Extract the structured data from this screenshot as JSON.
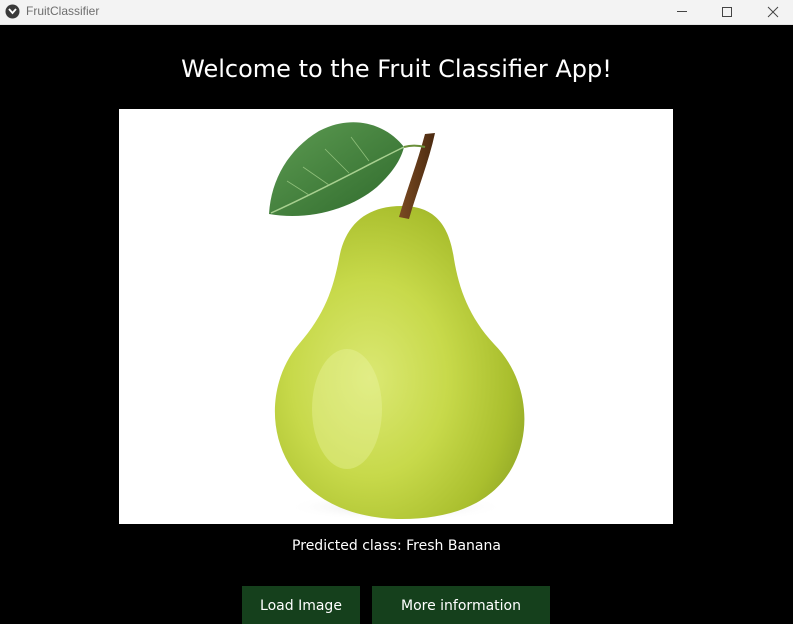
{
  "window": {
    "title": "FruitClassifier",
    "controls": {
      "minimize_icon": "minimize-icon",
      "maximize_icon": "maximize-icon",
      "close_icon": "close-icon"
    }
  },
  "main": {
    "heading": "Welcome to the Fruit Classifier App!",
    "image": {
      "subject": "pear-image",
      "background": "#ffffff"
    },
    "prediction_text": "Predicted class: Fresh Banana",
    "buttons": {
      "load_label": "Load Image",
      "info_label": "More information"
    }
  },
  "colors": {
    "background": "#000000",
    "button": "#15401c",
    "text": "#ffffff",
    "titlebar": "#f3f3f3"
  }
}
